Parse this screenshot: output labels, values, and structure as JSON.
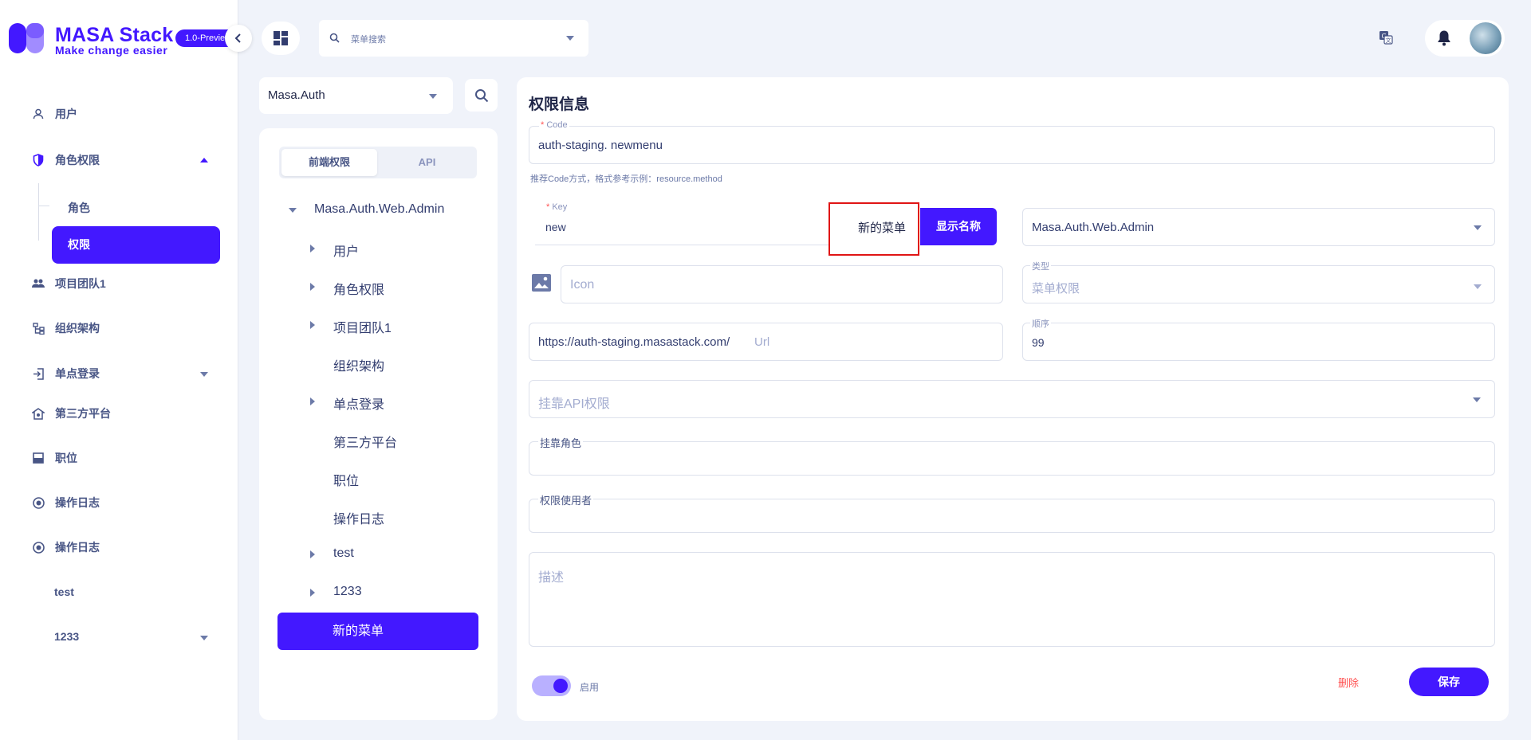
{
  "brand": {
    "title": "MASA Stack",
    "slogan": "Make change easier",
    "version": "1.0-Preview"
  },
  "topbar": {
    "search_placeholder": "菜单搜索"
  },
  "sidebar": {
    "items": [
      {
        "label": "用户",
        "icon": "user-icon"
      },
      {
        "label": "角色权限",
        "icon": "shield-icon",
        "expanded": true
      },
      {
        "label": "角色"
      },
      {
        "label": "权限",
        "active": true
      },
      {
        "label": "项目团队1",
        "icon": "team-icon"
      },
      {
        "label": "组织架构",
        "icon": "org-chart-icon"
      },
      {
        "label": "单点登录",
        "icon": "login-icon"
      },
      {
        "label": "第三方平台",
        "icon": "platform-icon"
      },
      {
        "label": "职位",
        "icon": "position-icon"
      },
      {
        "label": "操作日志",
        "icon": "log-icon"
      },
      {
        "label": "操作日志",
        "icon": "log-icon"
      },
      {
        "label": "test"
      },
      {
        "label": "1233"
      }
    ]
  },
  "app_selector": {
    "value": "Masa.Auth"
  },
  "tree": {
    "tabs": [
      "前端权限",
      "API"
    ],
    "root": "Masa.Auth.Web.Admin",
    "nodes": [
      "用户",
      "角色权限",
      "项目团队1",
      "组织架构",
      "单点登录",
      "第三方平台",
      "职位",
      "操作日志",
      "test",
      "1233"
    ],
    "selected": "新的菜单"
  },
  "form": {
    "title": "权限信息",
    "code_label": "Code",
    "code_value": "auth-staging. newmenu",
    "code_hint": "推荐Code方式，格式参考示例：resource.method",
    "key_label": "Key",
    "key_value": "new",
    "display_name_value": "新的菜单",
    "display_name_button": "显示名称",
    "app_value": "Masa.Auth.Web.Admin",
    "icon_placeholder": "Icon",
    "type_label": "类型",
    "type_value": "菜单权限",
    "url_prefix": "https://auth-staging.masastack.com/",
    "url_placeholder": "Url",
    "order_label": "顺序",
    "order_value": "99",
    "api_placeholder": "挂靠API权限",
    "roles_label": "挂靠角色",
    "users_label": "权限使用者",
    "desc_placeholder": "描述",
    "enable_label": "启用",
    "enabled": true,
    "delete_label": "删除",
    "save_label": "保存"
  },
  "colors": {
    "primary": "#4318ff",
    "danger": "#ff5252",
    "highlight_box": "#e01515"
  }
}
